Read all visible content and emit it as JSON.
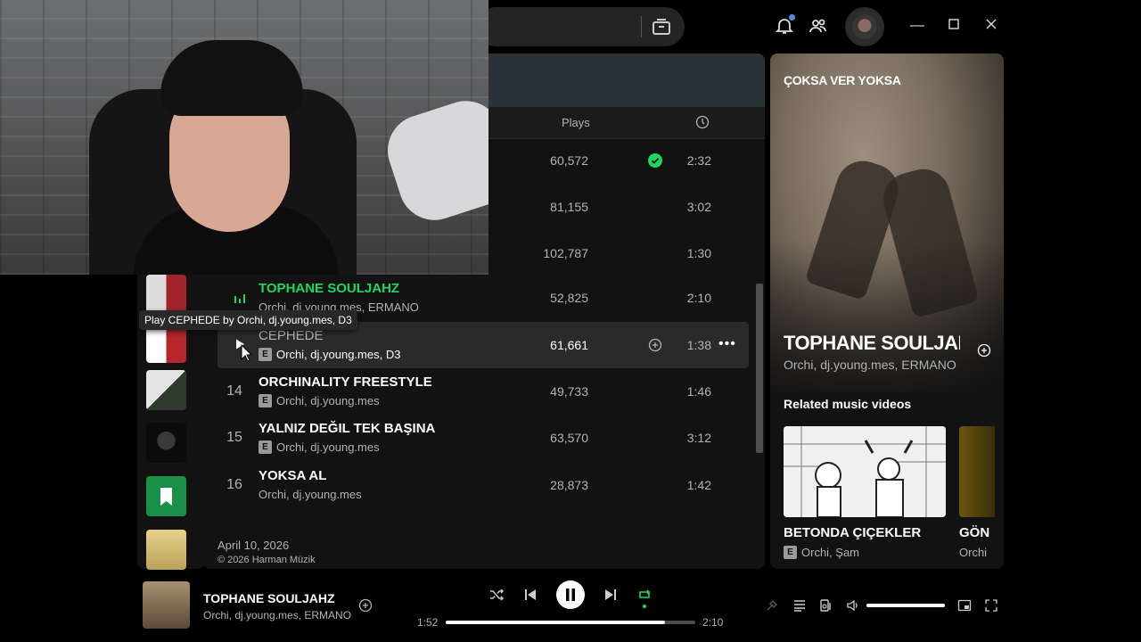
{
  "main": {
    "column_plays": "Plays",
    "tracks": [
      {
        "num": "",
        "title": "",
        "artists": "",
        "plays": "60,572",
        "duration": "2:32",
        "saved": true
      },
      {
        "num": "",
        "title": "",
        "artists": "",
        "plays": "81,155",
        "duration": "3:02"
      },
      {
        "num": "",
        "title": "",
        "artists": "",
        "plays": "102,787",
        "duration": "1:30"
      },
      {
        "num": "",
        "title": "TOPHANE SOULJAHZ",
        "artists": "Orchi, dj.young.mes, ERMANO",
        "plays": "52,825",
        "duration": "2:10",
        "playing": true
      },
      {
        "num": "",
        "title": "CEPHEDE",
        "artists": "Orchi, dj.young.mes, D3",
        "plays": "61,661",
        "duration": "1:38",
        "explicit": true,
        "hover": true
      },
      {
        "num": "14",
        "title": "ORCHINALITY FREESTYLE",
        "artists": "Orchi, dj.young.mes",
        "plays": "49,733",
        "duration": "1:46",
        "explicit": true
      },
      {
        "num": "15",
        "title": "YALNIZ DEĞIL TEK BAŞINA",
        "artists": "Orchi, dj.young.mes",
        "plays": "63,570",
        "duration": "3:12",
        "explicit": true
      },
      {
        "num": "16",
        "title": "YOKSA AL",
        "artists": "Orchi, dj.young.mes",
        "plays": "28,873",
        "duration": "1:42"
      }
    ],
    "release_date": "April 10, 2026",
    "copyright": "© 2026 Harman Müzik"
  },
  "tooltip": "Play CEPHEDE by Orchi, dj.young.mes, D3",
  "now_playing_panel": {
    "art_text": "ÇOKSA VER YOKSA",
    "title": "TOPHANE SOULJAHZ",
    "artists": "Orchi, dj.young.mes, ERMANO",
    "related_label": "Related music videos",
    "videos": [
      {
        "title": "BETONDA ÇIÇEKLER",
        "artists": "Orchi, Şam",
        "explicit": true
      },
      {
        "title": "GÖN",
        "artists": "Orchi"
      }
    ]
  },
  "player": {
    "title": "TOPHANE SOULJAHZ",
    "artists": "Orchi, dj.young.mes, ERMANO",
    "current_time": "1:52",
    "total_time": "2:10",
    "progress": 0.877,
    "volume": 1.0,
    "repeat_on": true
  },
  "colors": {
    "accent": "#1ed760",
    "background": "#121212",
    "surface": "#2a2a2a"
  }
}
